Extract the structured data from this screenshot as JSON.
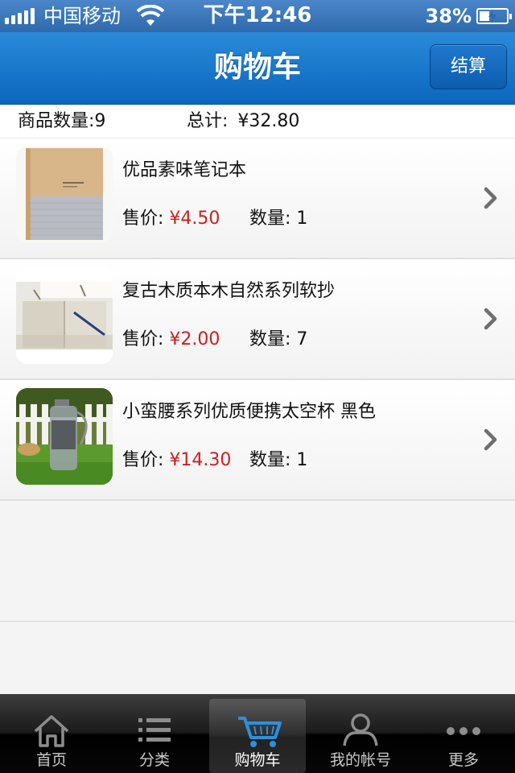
{
  "status_bar": {
    "carrier": "中国移动",
    "time": "下午12:46",
    "battery": "38%",
    "battery_level": 0.38,
    "signal_icon": "signal-bars-icon",
    "wifi_icon": "wifi-icon",
    "battery_icon": "battery-charging-icon"
  },
  "nav": {
    "title": "购物车",
    "checkout_label": "结算"
  },
  "summary": {
    "quantity_text": "商品数量:9",
    "total_label": "总计:",
    "total_value": "¥32.80"
  },
  "items": [
    {
      "name": "优品素味笔记本",
      "price_label": "售价: ",
      "price": "¥4.50",
      "qty_text": "数量: 1",
      "thumb_icon": "notebook-image"
    },
    {
      "name": "复古木质本木自然系列软抄",
      "price_label": "售价: ",
      "price": "¥2.00",
      "qty_text": "数量: 7",
      "thumb_icon": "open-notebook-image"
    },
    {
      "name": "小蛮腰系列优质便携太空杯 黑色",
      "price_label": "售价: ",
      "price": "¥14.30",
      "qty_text": "数量: 1",
      "thumb_icon": "water-bottle-image"
    }
  ],
  "tabs": [
    {
      "label": "首页",
      "icon": "home-icon"
    },
    {
      "label": "分类",
      "icon": "list-icon"
    },
    {
      "label": "购物车",
      "icon": "cart-icon",
      "active": true
    },
    {
      "label": "我的帐号",
      "icon": "user-icon"
    },
    {
      "label": "更多",
      "icon": "more-icon"
    }
  ],
  "colors": {
    "nav_blue": "#0a67bd",
    "price_red": "#cc1f1f",
    "active_tab_icon": "#2f8fd8"
  }
}
